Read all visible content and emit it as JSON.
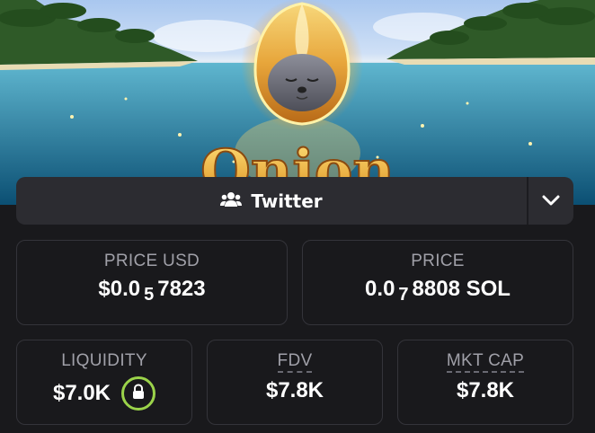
{
  "banner": {
    "token_name": "Onion",
    "image_description_icon": "seal-in-golden-onion-icon"
  },
  "social": {
    "twitter_label": "Twitter",
    "twitter_icon": "users-icon",
    "more_icon": "chevron-down-icon"
  },
  "stats": {
    "price_usd": {
      "title": "PRICE USD",
      "prefix": "$0.0",
      "sub": "5",
      "suffix": "7823"
    },
    "price": {
      "title": "PRICE",
      "prefix": "0.0",
      "sub": "7",
      "suffix": "8808 SOL"
    },
    "liquidity": {
      "title": "LIQUIDITY",
      "value": "$7.0K",
      "badge_icon": "lock-icon"
    },
    "fdv": {
      "title": "FDV",
      "value": "$7.8K"
    },
    "mkt_cap": {
      "title": "MKT CAP",
      "value": "$7.8K"
    }
  },
  "colors": {
    "background": "#19191c",
    "card_border": "#34343a",
    "bar_bg": "#2c2c31",
    "lock_ring": "#9bd34a",
    "gold": "#f2b53a"
  }
}
